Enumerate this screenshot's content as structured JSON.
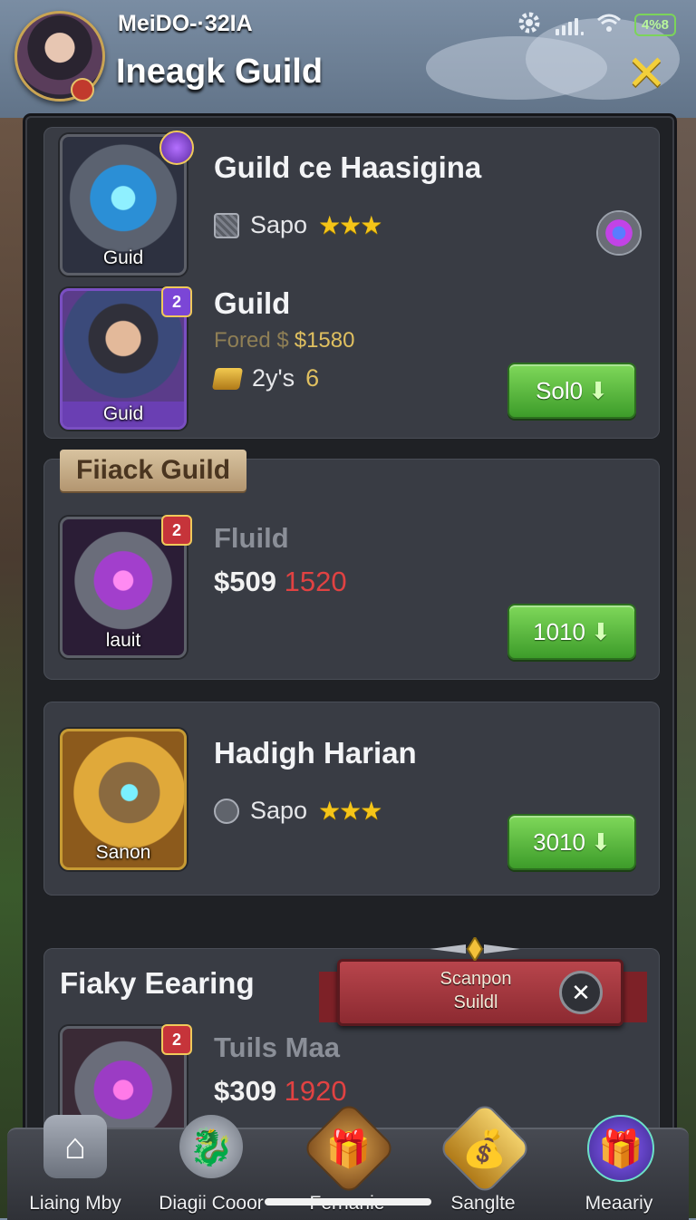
{
  "status_bar": {
    "title": "MeiDO-·32IA",
    "battery": "4%8",
    "icons": [
      "gear-icon",
      "signal-icon",
      "wifi-icon",
      "battery-icon"
    ]
  },
  "header": {
    "title": "Ineagk Guild",
    "close_icon": "close-icon",
    "avatar_icon": "avatar-icon"
  },
  "cards": [
    {
      "title": "Guild ce Haasigina",
      "thumb_label": "Guid",
      "meta_label": "Sapo",
      "stars": "★★★",
      "gem_icon": "gem-icon"
    },
    {
      "title": "Guild",
      "thumb_label": "Guid",
      "level": "2",
      "subline_prefix": "Fored $",
      "subline_value": "$1580",
      "stat_label": "2y's",
      "stat_value": "6",
      "button_label": "Sol0",
      "button_icon": "download-arrow-icon"
    },
    {
      "ribbon": "Fiiack Guild",
      "title": "Fluild",
      "thumb_label": "lauit",
      "level": "2",
      "price": "$509",
      "price_red": "1520",
      "button_label": "1010"
    },
    {
      "title": "Hadigh Harian",
      "thumb_label": "Sanon",
      "meta_label": "Sapo",
      "stars": "★★★",
      "button_label": "3010"
    },
    {
      "title": "Fiaky Eearing",
      "subtitle": "Tuils Maa",
      "level": "2",
      "price": "$309",
      "price_red": "1920"
    }
  ],
  "banner": {
    "line1": "Scanpon",
    "line2": "Suildl",
    "close": "✕"
  },
  "bottom_nav": [
    {
      "label": "Liaing Mby",
      "icon": "home-icon"
    },
    {
      "label": "Diagii Cooor",
      "icon": "dragon-icon"
    },
    {
      "label": "Fernanie",
      "icon": "chest-icon"
    },
    {
      "label": "Sanglte",
      "icon": "gold-bars-icon"
    },
    {
      "label": "Meaariy",
      "icon": "gift-icon"
    }
  ],
  "colors": {
    "accent_green": "#4caf35",
    "price_red": "#e14242",
    "star_gold": "#f5c518",
    "close_yellow": "#f3cf3a"
  }
}
